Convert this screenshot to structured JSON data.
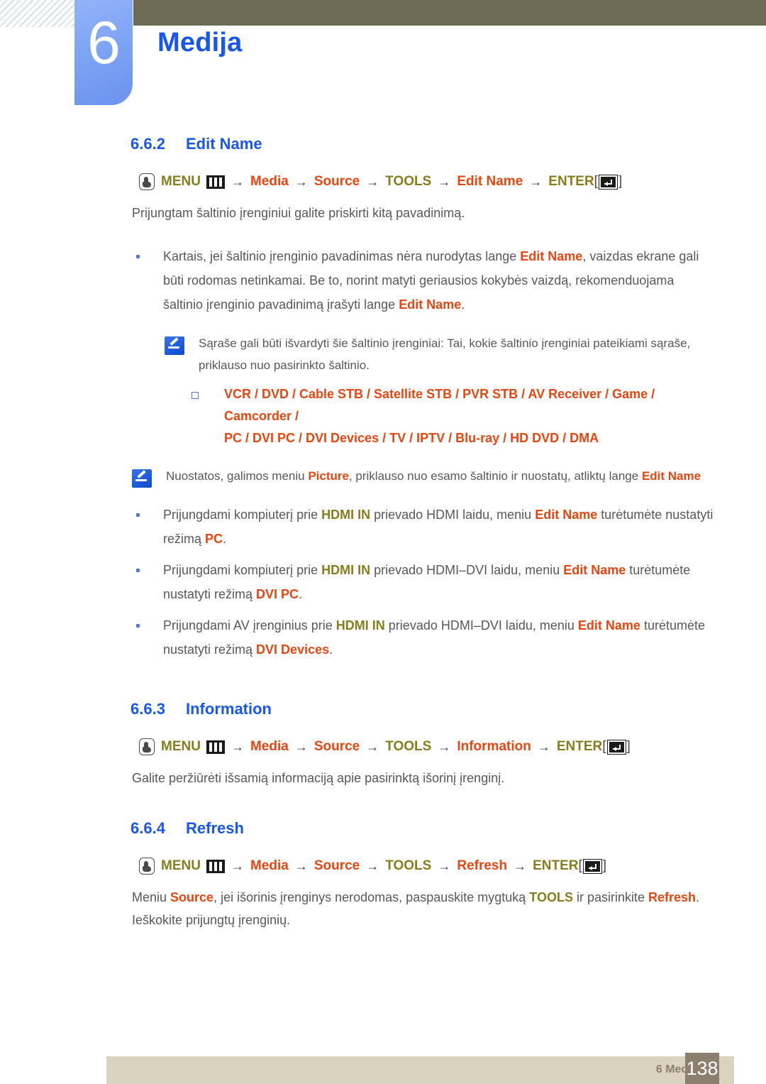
{
  "header": {
    "chapter_number": "6",
    "chapter_title": "Medija",
    "accent_blue": "#1756ef",
    "olive": "#6d6b54",
    "tab_blue": "#7ea4f4"
  },
  "sections": [
    {
      "number": "6.6.2",
      "title": "Edit Name",
      "path": {
        "menu_label": "MENU",
        "items": [
          "Media",
          "Source",
          "TOOLS",
          "Edit Name"
        ],
        "enter_label": "ENTER",
        "arrow": "→",
        "bracket_open": "[",
        "bracket_close": "]"
      },
      "intro": "Prijungtam šaltinio įrenginiui galite priskirti kitą pavadinimą."
    },
    {
      "number": "6.6.3",
      "title": "Information",
      "path": {
        "menu_label": "MENU",
        "items": [
          "Media",
          "Source",
          "TOOLS",
          "Information"
        ],
        "enter_label": "ENTER"
      },
      "intro": "Galite peržiūrėti išsamią informaciją apie pasirinktą išorinį įrenginį."
    },
    {
      "number": "6.6.4",
      "title": "Refresh",
      "path": {
        "menu_label": "MENU",
        "items": [
          "Media",
          "Source",
          "TOOLS",
          "Refresh"
        ],
        "enter_label": "ENTER"
      }
    }
  ],
  "bullets": {
    "edit_name_1": {
      "t1": "Kartais, jei šaltinio įrenginio pavadinimas nėra nurodytas lange ",
      "h1": "Edit Name",
      "t2": ", vaizdas ekrane gali būti rodomas netinkamai. Be to, norint matyti geriausios kokybės vaizdą, rekomenduojama šaltinio įrenginio pavadinimą įrašyti lange ",
      "h2": "Edit Name",
      "t3": "."
    },
    "hdmi_pc": {
      "t1": "Prijungdami kompiuterį prie ",
      "h1": "HDMI IN",
      "t2": " prievado HDMI laidu, meniu ",
      "h2": "Edit Name",
      "t3": " turėtumėte nustatyti režimą ",
      "h3": "PC",
      "t4": "."
    },
    "hdmi_dvi_pc": {
      "t1": "Prijungdami kompiuterį prie ",
      "h1": "HDMI IN",
      "t2": " prievado HDMI–DVI laidu, meniu ",
      "h2": "Edit Name",
      "t3": " turėtumėte nustatyti režimą ",
      "h3": "DVI PC",
      "t4": "."
    },
    "hdmi_dvi_dev": {
      "t1": "Prijungdami AV įrenginius prie ",
      "h1": "HDMI IN",
      "t2": " prievado HDMI–DVI laidu, meniu ",
      "h2": "Edit Name",
      "t3": " turėtumėte nustatyti režimą ",
      "h3": "DVI Devices",
      "t4": "."
    }
  },
  "notes": {
    "source_list": "Sąraše gali būti išvardyti šie šaltinio įrenginiai: Tai, kokie šaltinio įrenginiai pateikiami sąraše, priklauso nuo pasirinkto šaltinio.",
    "picture_note": {
      "t1": "Nuostatos, galimos meniu ",
      "h1": "Picture",
      "t2": ", priklauso nuo esamo šaltinio ir nuostatų, atliktų lange ",
      "h2": "Edit Name"
    }
  },
  "device_list": {
    "line1": "VCR / DVD / Cable STB / Satellite STB / PVR STB / AV Receiver / Game / Camcorder /",
    "line2": "PC / DVI PC / DVI Devices / TV / IPTV / Blu-ray / HD DVD / DMA"
  },
  "refresh_para": {
    "t1": "Meniu ",
    "h1": "Source",
    "t2": ", jei išorinis įrenginys nerodomas, paspauskite mygtuką ",
    "h2": "TOOLS",
    "t3": " ir pasirinkite ",
    "h3": "Refresh",
    "t4": ". Ieškokite prijungtų įrenginių."
  },
  "footer": {
    "label": "6 Medija",
    "page_number": "138"
  }
}
